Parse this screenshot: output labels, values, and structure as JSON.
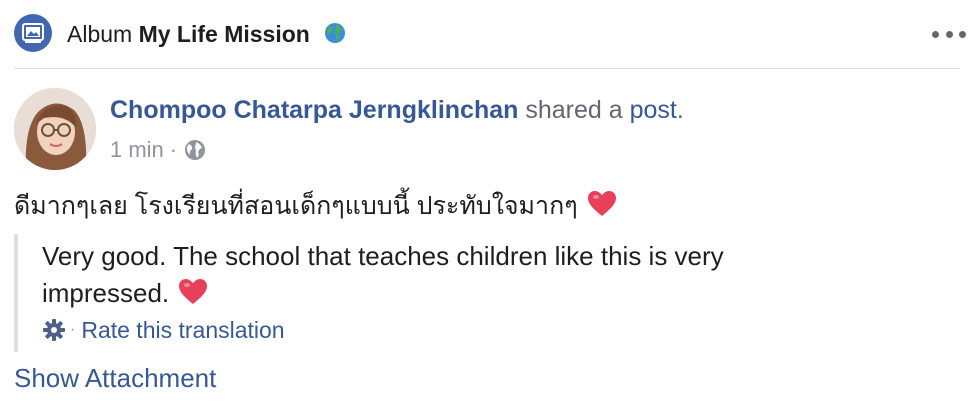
{
  "header": {
    "lead": "Album",
    "album_name": "My Life Mission",
    "album_emoji_icon": "globe-emoji"
  },
  "post": {
    "author": "Chompoo Chatarpa Jerngklinchan",
    "shared_text": "shared a",
    "post_link": "post",
    "period": ".",
    "time": "1 min",
    "meta_separator": "·",
    "privacy_icon": "globe-icon",
    "text": "ดีมากๆเลย โรงเรียนที่สอนเด็กๆแบบนี้ ประทับใจมากๆ"
  },
  "translation": {
    "text": "Very good. The school that teaches children like this is very impressed.",
    "tools_separator": "·",
    "rate_label": "Rate this translation"
  },
  "footer": {
    "show_attachment": "Show Attachment"
  },
  "colors": {
    "link": "#365899",
    "accent": "#4267b2",
    "meta": "#90949c",
    "heart": "#e8405a"
  }
}
